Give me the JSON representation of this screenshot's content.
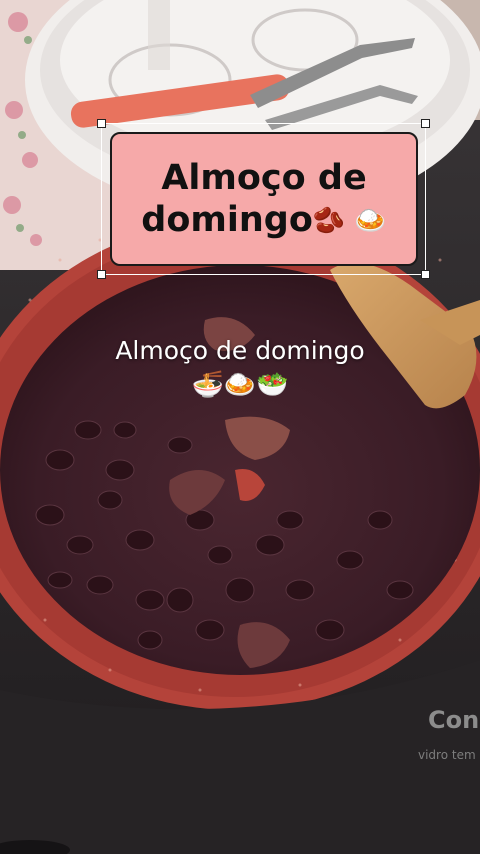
{
  "sticker": {
    "line1": "Almoço de",
    "line2": "domingo",
    "emojis": "🫘 🍛"
  },
  "caption": {
    "text": "Almoço de domingo",
    "emojis": "🍜🍛🥗"
  },
  "stove_brand": {
    "name": "Con",
    "sub": "vidro tem"
  },
  "colors": {
    "sticker_fill": "#f6a9a9",
    "pan_rim": "#b4433a",
    "beans": "#3a1c24"
  }
}
